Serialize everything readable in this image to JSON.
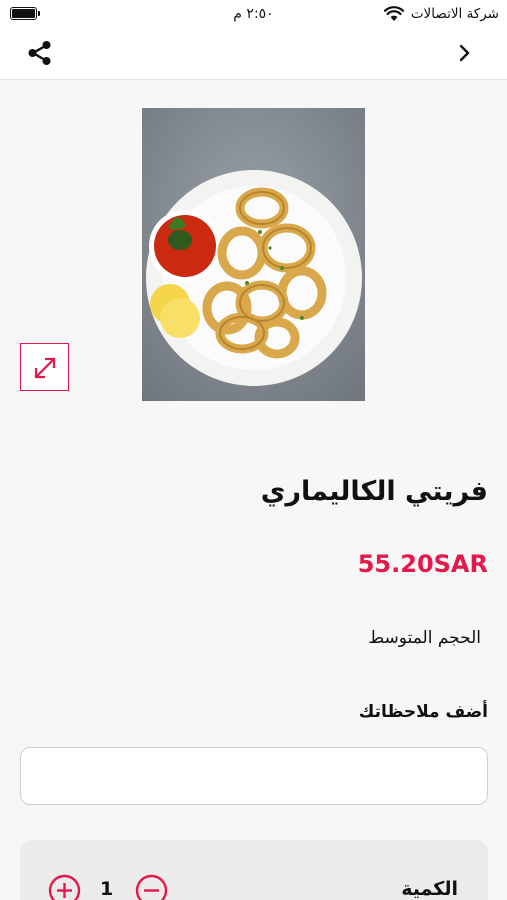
{
  "status_bar": {
    "time": "٢:٥٠ م",
    "carrier": "شركة الاتصالات"
  },
  "nav": {
    "share_icon": "share-icon",
    "back_icon": "chevron-right-icon"
  },
  "product": {
    "title": "فريتي الكاليماري",
    "price": "55.20SAR",
    "size": "الحجم المتوسط",
    "image_alt": "fried calamari plate"
  },
  "notes": {
    "label": "أضف ملاحظاتك",
    "value": "",
    "placeholder": ""
  },
  "quantity": {
    "label": "الكمية",
    "value": "1"
  },
  "colors": {
    "accent": "#e3184b",
    "background": "#f7f7f7"
  }
}
